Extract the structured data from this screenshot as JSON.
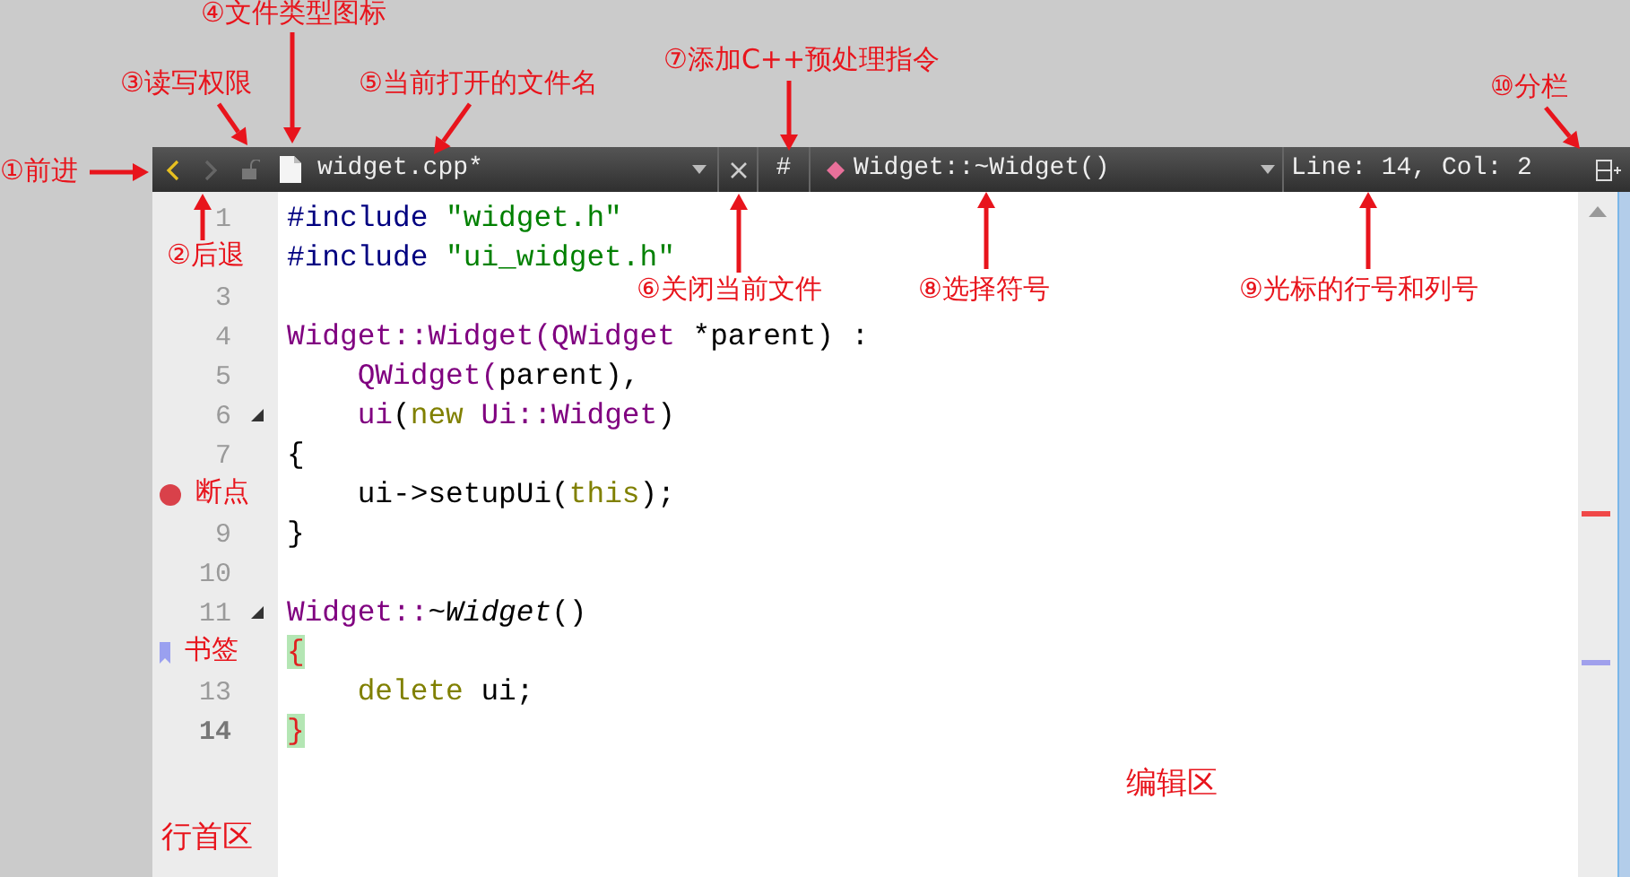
{
  "toolbar": {
    "back": {
      "enabled": true
    },
    "forward": {
      "enabled": false
    },
    "read_only": false,
    "filename": "widget.cpp*",
    "preprocessor_button": "#",
    "symbol": "Widget::~Widget()",
    "cursor_position": "Line: 14, Col: 2"
  },
  "lines": [
    {
      "kind": "numbered",
      "number": "1",
      "fold": false,
      "current": false,
      "tokens": [
        {
          "t": "#include ",
          "kind": "preproc"
        },
        {
          "t": "\"widget.h\"",
          "kind": "string"
        }
      ]
    },
    {
      "kind": "covered",
      "fold": false,
      "tokens": [
        {
          "t": "#include ",
          "kind": "preproc"
        },
        {
          "t": "\"ui_widget.h\"",
          "kind": "string"
        }
      ]
    },
    {
      "kind": "numbered",
      "number": "3",
      "fold": false,
      "current": false
    },
    {
      "kind": "numbered",
      "number": "4",
      "fold": false,
      "current": false,
      "tokens": [
        {
          "t": "Widget::Widget(",
          "kind": "type"
        },
        {
          "t": "QWidget",
          "kind": "type"
        },
        {
          "t": " *parent) :",
          "kind": "plain"
        }
      ]
    },
    {
      "kind": "numbered",
      "number": "5",
      "fold": false,
      "current": false,
      "tokens": [
        {
          "t": "    QWidget(",
          "kind": "type"
        },
        {
          "t": "parent),",
          "kind": "plain"
        }
      ]
    },
    {
      "kind": "numbered",
      "number": "6",
      "fold": true,
      "current": false,
      "tokens": [
        {
          "t": "    ui",
          "kind": "type"
        },
        {
          "t": "(",
          "kind": "plain"
        },
        {
          "t": "new ",
          "kind": "keyword"
        },
        {
          "t": "Ui::Widget",
          "kind": "type"
        },
        {
          "t": ")",
          "kind": "plain"
        }
      ]
    },
    {
      "kind": "numbered",
      "number": "7",
      "fold": false,
      "current": false,
      "tokens": [
        {
          "t": "{",
          "kind": "plain"
        }
      ]
    },
    {
      "kind": "breakpoint",
      "note": "断点",
      "fold": false,
      "tokens": [
        {
          "t": "    ui->setupUi(",
          "kind": "plain"
        },
        {
          "t": "this",
          "kind": "keyword"
        },
        {
          "t": ");",
          "kind": "plain"
        }
      ]
    },
    {
      "kind": "numbered",
      "number": "9",
      "fold": false,
      "current": false,
      "tokens": [
        {
          "t": "}",
          "kind": "plain"
        }
      ]
    },
    {
      "kind": "numbered",
      "number": "10",
      "fold": false,
      "current": false
    },
    {
      "kind": "numbered",
      "number": "11",
      "fold": true,
      "current": false,
      "tokens": [
        {
          "t": "Widget::",
          "kind": "type"
        },
        {
          "t": "~",
          "kind": "plain"
        },
        {
          "t": "Widget",
          "kind": "italic"
        },
        {
          "t": "()",
          "kind": "plain"
        }
      ]
    },
    {
      "kind": "bookmark",
      "note": "书签",
      "fold": false,
      "tokens": [
        {
          "t": "{",
          "kind": "brace"
        }
      ]
    },
    {
      "kind": "numbered",
      "number": "13",
      "fold": false,
      "current": false,
      "tokens": [
        {
          "t": "    delete",
          "kind": "keyword"
        },
        {
          "t": " ui;",
          "kind": "plain"
        }
      ]
    },
    {
      "kind": "numbered",
      "number": "14",
      "fold": false,
      "current": true,
      "tokens": [
        {
          "t": "}",
          "kind": "brace"
        }
      ]
    }
  ],
  "annotations": [
    {
      "text": "④文件类型图标"
    },
    {
      "text": "⑦添加C++预处理指令"
    },
    {
      "text": "③读写权限"
    },
    {
      "text": "⑤当前打开的文件名"
    },
    {
      "text": "⑩分栏"
    },
    {
      "text": "①前进"
    },
    {
      "text": "②后退"
    },
    {
      "text": "⑥关闭当前文件"
    },
    {
      "text": "⑧选择符号"
    },
    {
      "text": "⑨光标的行号和列号"
    },
    {
      "text": "编辑区"
    },
    {
      "text": "行首区"
    }
  ]
}
